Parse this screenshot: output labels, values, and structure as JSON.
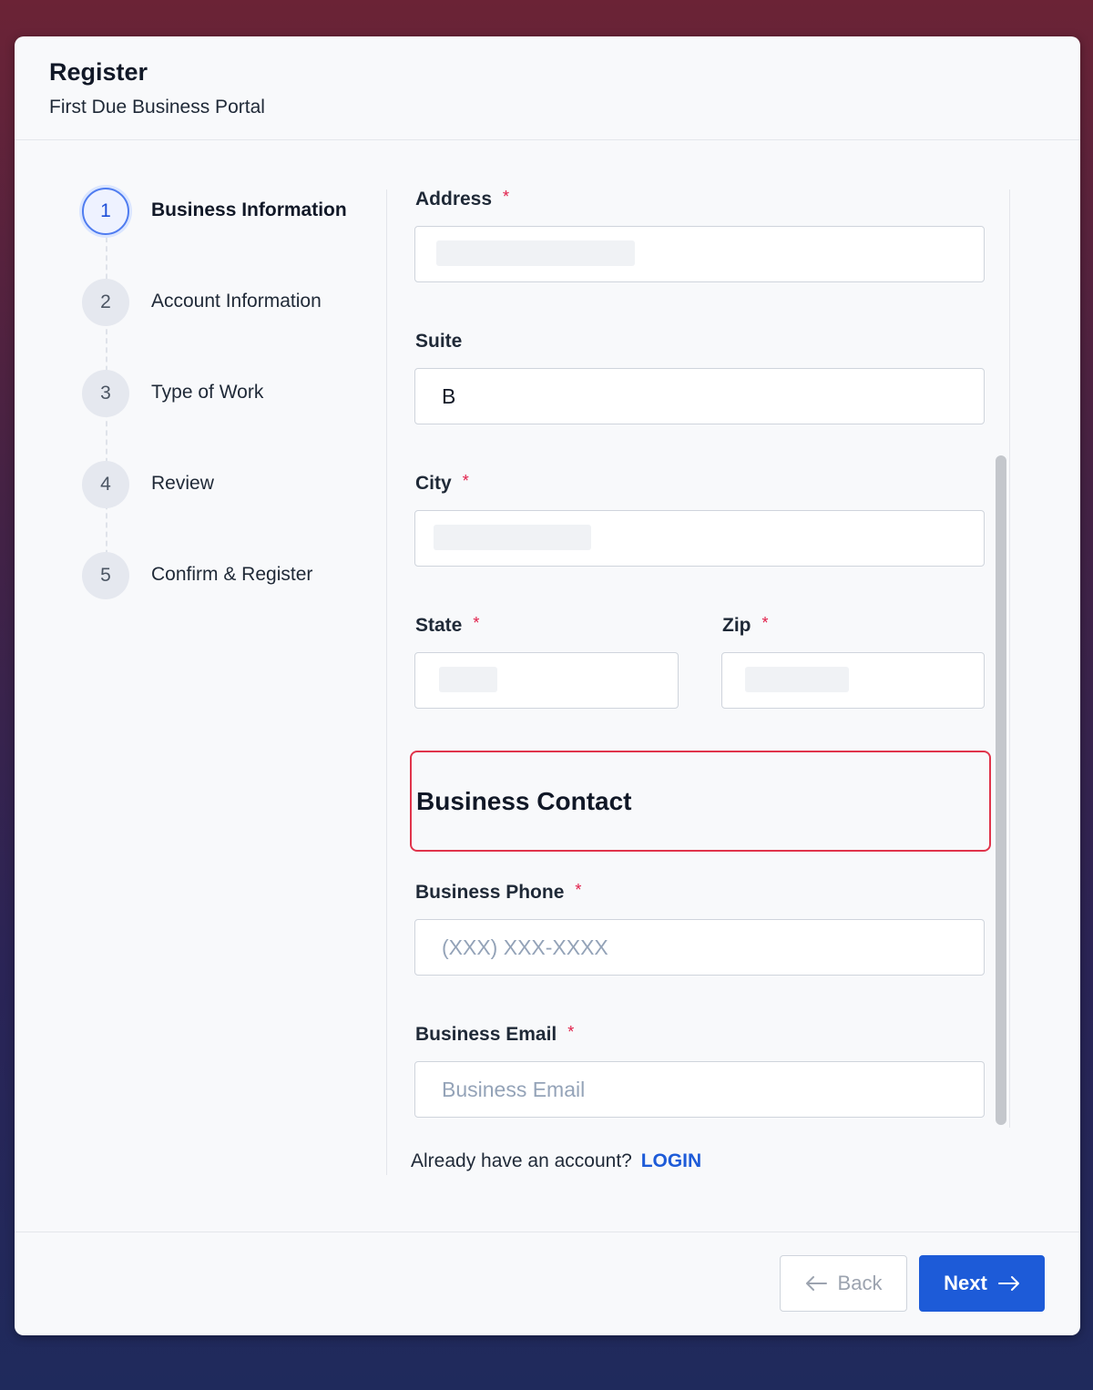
{
  "header": {
    "title": "Register",
    "subtitle": "First Due Business Portal"
  },
  "steps": [
    {
      "number": "1",
      "label": "Business Information",
      "active": true
    },
    {
      "number": "2",
      "label": "Account Information",
      "active": false
    },
    {
      "number": "3",
      "label": "Type of Work",
      "active": false
    },
    {
      "number": "4",
      "label": "Review",
      "active": false
    },
    {
      "number": "5",
      "label": "Confirm & Register",
      "active": false
    }
  ],
  "form": {
    "required_mark": "*",
    "address": {
      "label": "Address",
      "value": ""
    },
    "suite": {
      "label": "Suite",
      "value": "B"
    },
    "city": {
      "label": "City",
      "value": ""
    },
    "state": {
      "label": "State",
      "value": ""
    },
    "zip": {
      "label": "Zip",
      "value": ""
    },
    "section_title": "Business Contact",
    "phone": {
      "label": "Business Phone",
      "placeholder": "(XXX) XXX-XXXX"
    },
    "email": {
      "label": "Business Email",
      "placeholder": "Business Email"
    }
  },
  "login": {
    "prompt": "Already have an account?",
    "link": "LOGIN"
  },
  "buttons": {
    "back": "Back",
    "next": "Next"
  },
  "icons": {
    "back": "arrow-left-icon",
    "next": "arrow-right-icon"
  },
  "colors": {
    "accent": "#1d5bd8",
    "required": "#e11d48",
    "highlight": "#e0344b"
  }
}
